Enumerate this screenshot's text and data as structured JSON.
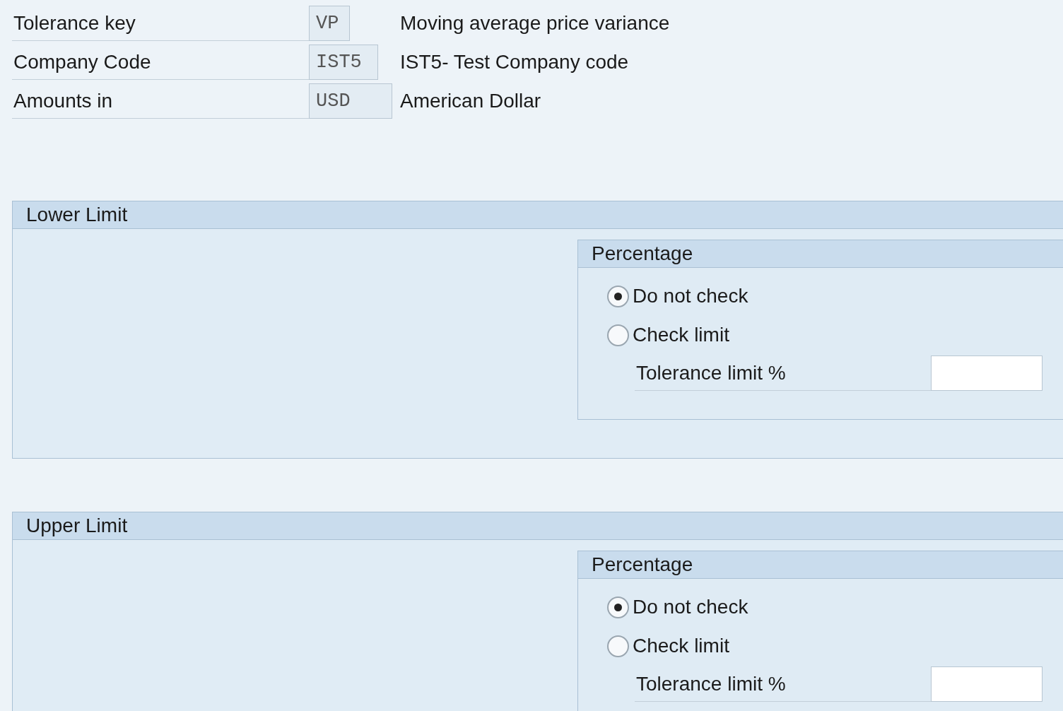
{
  "header_fields": [
    {
      "label": "Tolerance key",
      "value": "VP",
      "description": "Moving average price variance"
    },
    {
      "label": "Company Code",
      "value": "IST5",
      "description": "IST5- Test Company code"
    },
    {
      "label": "Amounts in",
      "value": "USD",
      "description": "American Dollar"
    }
  ],
  "groups": [
    {
      "title": "Lower Limit",
      "subgroup": {
        "title": "Percentage",
        "options": [
          {
            "label": "Do not check",
            "selected": true
          },
          {
            "label": "Check limit",
            "selected": false
          }
        ],
        "limit_field": {
          "label": "Tolerance limit %"
        }
      }
    },
    {
      "title": "Upper Limit",
      "subgroup": {
        "title": "Percentage",
        "options": [
          {
            "label": "Do not check",
            "selected": true
          },
          {
            "label": "Check limit",
            "selected": false
          }
        ],
        "limit_field": {
          "label": "Tolerance limit %"
        }
      }
    }
  ]
}
